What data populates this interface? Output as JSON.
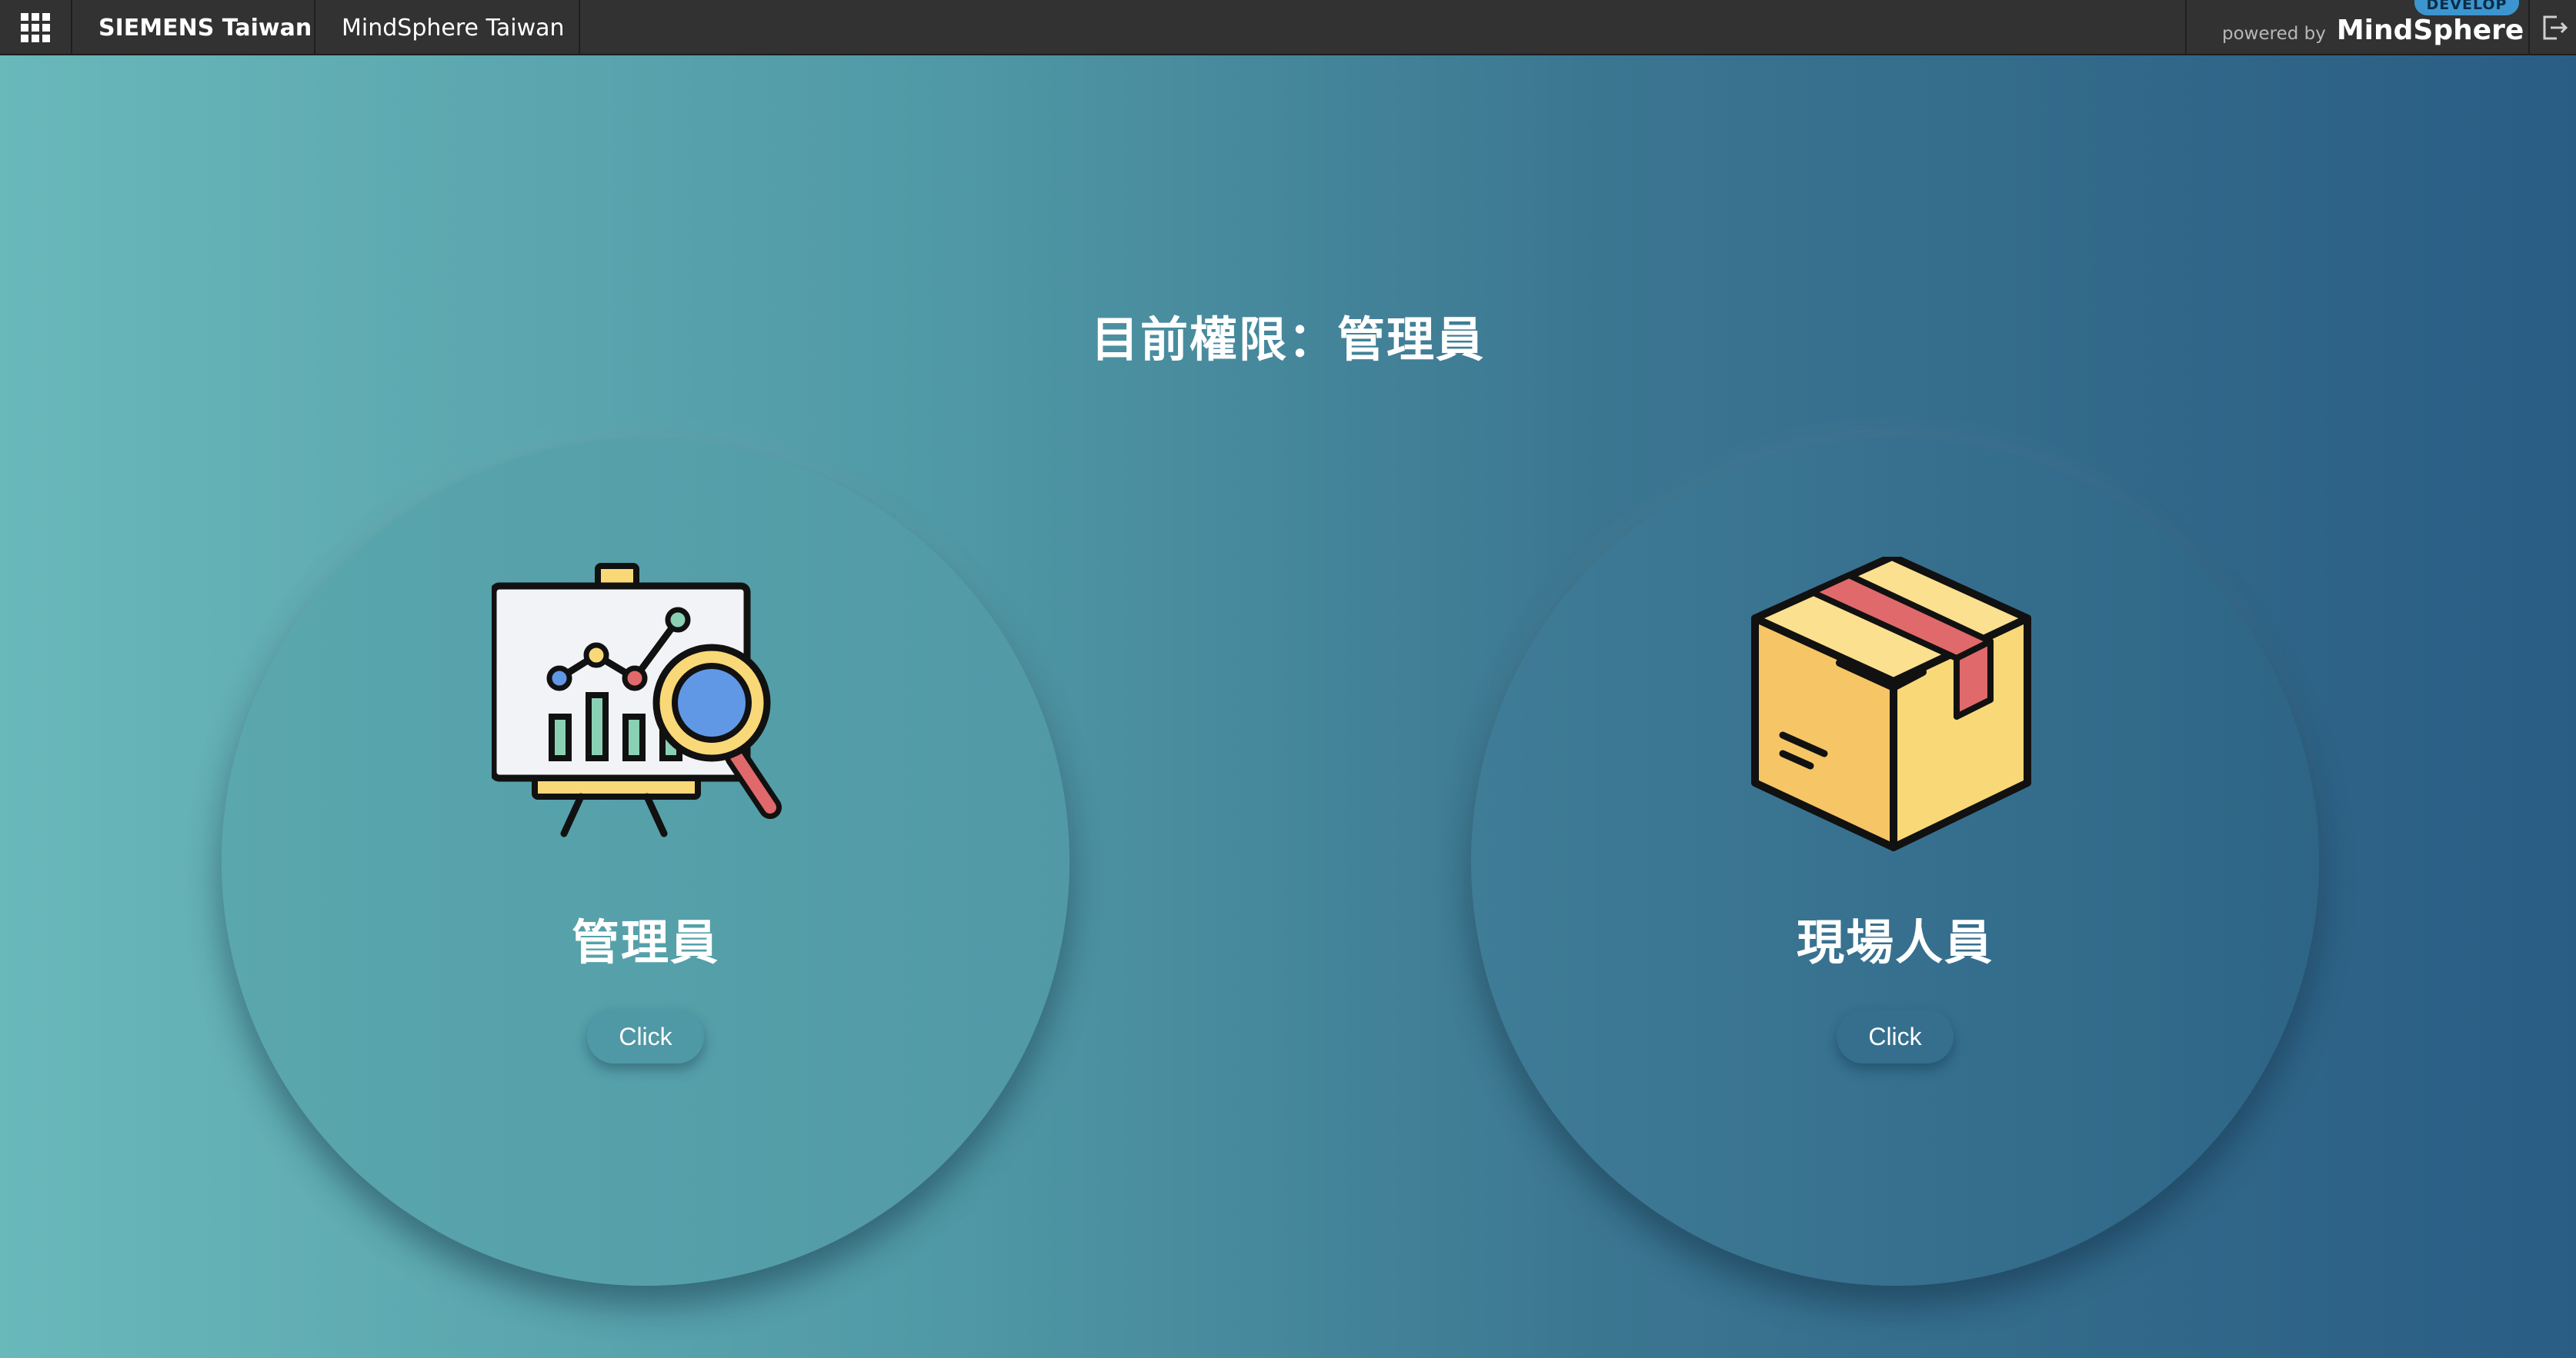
{
  "topbar": {
    "company": "SIEMENS Taiwan",
    "app_name": "MindSphere Taiwan",
    "powered_by_label": "powered by",
    "powered_by_name": "MindSphere",
    "environment_badge": "DEVELOP",
    "app_switcher_icon": "grid-icon",
    "logout_icon": "logout-icon"
  },
  "main": {
    "title": "目前權限：管理員",
    "roles": [
      {
        "label": "管理員",
        "button_label": "Click",
        "icon": "presentation-chart-icon"
      },
      {
        "label": "現場人員",
        "button_label": "Click",
        "icon": "package-box-icon"
      }
    ]
  },
  "colors": {
    "topbar_bg": "#323232",
    "gradient_start": "#69b8ba",
    "gradient_end": "#2a5d84",
    "badge": "#3c95cf",
    "icon_yellow": "#f9d878",
    "icon_red": "#e0696b",
    "icon_blue": "#6198e6",
    "icon_teal": "#8ad1b4"
  }
}
